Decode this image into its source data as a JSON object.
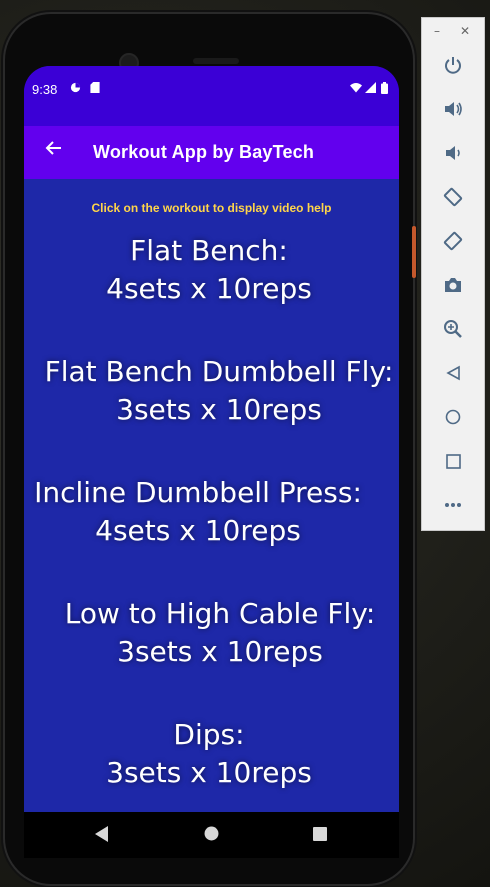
{
  "status": {
    "time": "9:38",
    "icons": [
      "data-saver-icon",
      "sd-card-icon",
      "wifi-icon",
      "signal-icon",
      "battery-icon"
    ]
  },
  "appbar": {
    "title": "Workout App by BayTech",
    "back_icon": "arrow-left-icon"
  },
  "content": {
    "hint": "Click on the workout to display video help",
    "workouts": [
      {
        "name": "Flat Bench:",
        "detail": "4sets x 10reps"
      },
      {
        "name": "Flat Bench Dumbbell Fly:",
        "detail": "3sets x 10reps"
      },
      {
        "name": "Incline Dumbbell Press:",
        "detail": "4sets x 10reps"
      },
      {
        "name": "Low to High Cable Fly:",
        "detail": "3sets x 10reps"
      },
      {
        "name": "Dips:",
        "detail": "3sets x 10reps"
      }
    ]
  },
  "navbar": [
    "back-triangle-icon",
    "home-circle-icon",
    "recents-square-icon"
  ],
  "emulator_panel": {
    "window_controls": [
      "minimize-icon",
      "close-icon"
    ],
    "buttons": [
      "power-icon",
      "volume-up-icon",
      "volume-down-icon",
      "rotate-left-icon",
      "rotate-right-icon",
      "camera-icon",
      "zoom-icon",
      "back-icon",
      "home-icon",
      "overview-icon",
      "more-icon"
    ]
  },
  "colors": {
    "status_bar": "#3b00d6",
    "app_bar": "#6200ee",
    "content_bg": "#1e28a8",
    "hint_text": "#ffd54a"
  }
}
